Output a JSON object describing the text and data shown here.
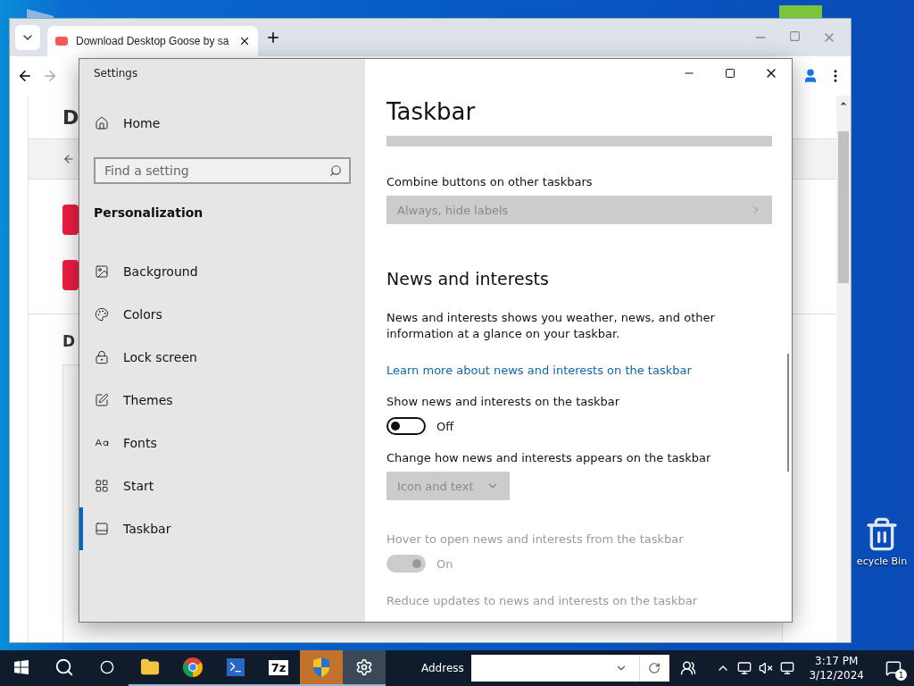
{
  "browser": {
    "tab": {
      "title": "Download Desktop Goose by sa",
      "selected": true
    },
    "page": {
      "headings": [
        "D",
        "D"
      ]
    }
  },
  "settings": {
    "window": {
      "title": "Settings"
    },
    "sidebar": {
      "home": "Home",
      "search": {
        "placeholder": "Find a setting"
      },
      "section": "Personalization",
      "items": [
        {
          "label": "Background",
          "selected": false
        },
        {
          "label": "Colors",
          "selected": false
        },
        {
          "label": "Lock screen",
          "selected": false
        },
        {
          "label": "Themes",
          "selected": false
        },
        {
          "label": "Fonts",
          "selected": false
        },
        {
          "label": "Start",
          "selected": false
        },
        {
          "label": "Taskbar",
          "selected": true
        }
      ]
    },
    "content": {
      "title": "Taskbar",
      "rows": [
        {
          "kind": "clipped-combo",
          "disabled": true
        },
        {
          "kind": "wide-combo",
          "label": "Combine buttons on other taskbars",
          "value": "Always, hide labels",
          "disabled": true
        },
        {
          "kind": "heading",
          "text": "News and interests"
        },
        {
          "kind": "paragraph",
          "text": "News and interests shows you weather, news, and other information at a glance on your taskbar."
        },
        {
          "kind": "link",
          "text": "Learn more about news and interests on the taskbar"
        },
        {
          "kind": "toggle",
          "label": "Show news and interests on the taskbar",
          "on": false,
          "state_text": "Off",
          "disabled": false
        },
        {
          "kind": "combo",
          "label": "Change how news and interests appears on the taskbar",
          "value": "Icon and text",
          "disabled": true
        },
        {
          "kind": "toggle",
          "label": "Hover to open news and interests from the taskbar",
          "on": true,
          "state_text": "On",
          "disabled": true
        },
        {
          "kind": "label",
          "text": "Reduce updates to news and interests on the taskbar",
          "disabled": true
        }
      ]
    }
  },
  "desktop_icons": [
    {
      "label": "ecycle Bin"
    }
  ],
  "taskbar": {
    "apps": [
      {
        "kind": "start",
        "running": false,
        "selected": false,
        "attention": false
      },
      {
        "kind": "search",
        "running": false,
        "selected": false,
        "attention": false
      },
      {
        "kind": "cortana",
        "running": false,
        "selected": false,
        "attention": false
      },
      {
        "kind": "explorer",
        "running": true,
        "selected": false,
        "attention": false
      },
      {
        "kind": "chrome",
        "running": true,
        "selected": false,
        "attention": false
      },
      {
        "kind": "powershell",
        "running": true,
        "selected": false,
        "attention": false
      },
      {
        "kind": "archiver",
        "label": "7z",
        "running": true,
        "selected": false,
        "attention": false
      },
      {
        "kind": "shield",
        "running": true,
        "selected": false,
        "attention": true
      },
      {
        "kind": "settings",
        "running": true,
        "selected": true,
        "attention": false
      }
    ],
    "address": {
      "label": "Address"
    },
    "clock": {
      "time": "3:17 PM",
      "date": "3/12/2024"
    },
    "notifications": {
      "badge": "1"
    }
  }
}
